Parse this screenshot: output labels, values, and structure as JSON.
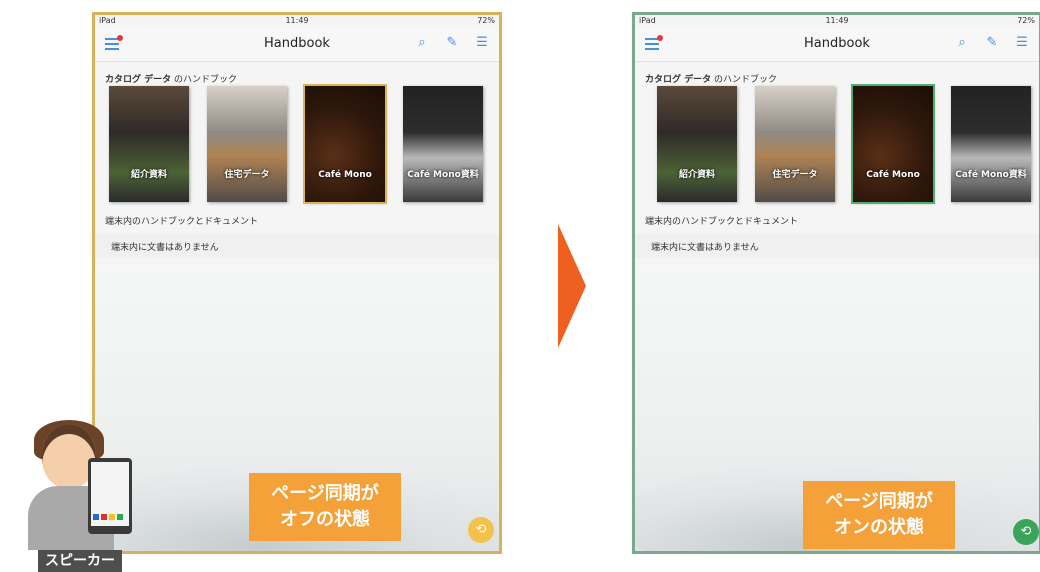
{
  "left": {
    "status": {
      "carrier": "iPad",
      "time": "11:49",
      "battery": "72%"
    },
    "nav": {
      "title": "Handbook"
    },
    "catalog_label_bold": "カタログ データ",
    "catalog_label_rest": " のハンドブック",
    "books": [
      {
        "label": "紹介資料"
      },
      {
        "label": "住宅データ"
      },
      {
        "label": "Café Mono"
      },
      {
        "label": "Café Mono資料"
      }
    ],
    "docs_label": "端末内のハンドブックとドキュメント",
    "empty_label": "端末内に文書はありません",
    "callout": {
      "line1": "ページ同期が",
      "line2": "オフの状態"
    }
  },
  "right": {
    "status": {
      "carrier": "iPad",
      "time": "11:49",
      "battery": "72%"
    },
    "nav": {
      "title": "Handbook"
    },
    "catalog_label_bold": "カタログ データ",
    "catalog_label_rest": " のハンドブック",
    "books": [
      {
        "label": "紹介資料"
      },
      {
        "label": "住宅データ"
      },
      {
        "label": "Café Mono"
      },
      {
        "label": "Café Mono資料"
      }
    ],
    "docs_label": "端末内のハンドブックとドキュメント",
    "empty_label": "端末内に文書はありません",
    "callout": {
      "line1": "ページ同期が",
      "line2": "オンの状態"
    }
  },
  "speaker_label": "スピーカー",
  "colors": {
    "accent": "#4a90d9",
    "callout": "#f4a13a",
    "arrow": "#ef5f1f",
    "sync_off": "#f2c24d",
    "sync_on": "#3aa55a"
  },
  "icons": [
    "menu-icon",
    "search-icon",
    "edit-icon",
    "list-icon",
    "sync-off-icon",
    "sync-on-icon"
  ]
}
